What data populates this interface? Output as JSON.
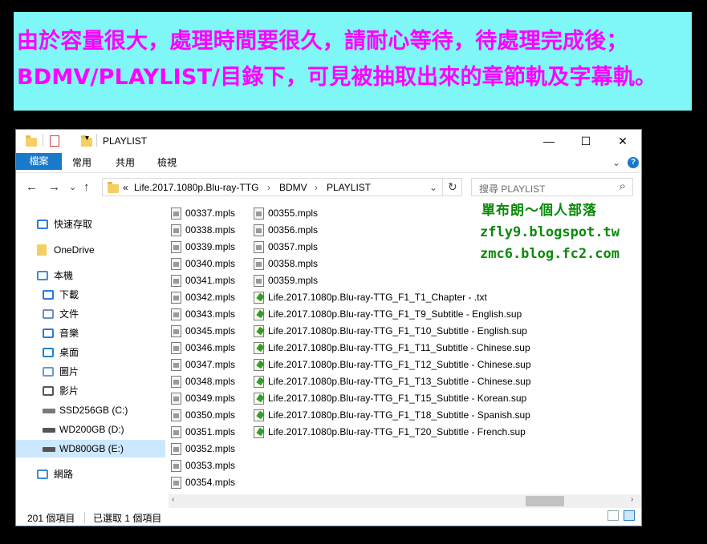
{
  "banner": {
    "line1": "由於容量很大，處理時間要很久，請耐心等待，待處理完成後；",
    "line2": "BDMV/PLAYLIST/目錄下，可見被抽取出來的章節軌及字幕軌。"
  },
  "window": {
    "title": "PLAYLIST",
    "controls": {
      "minimize": "—",
      "maximize": "☐",
      "close": "✕"
    }
  },
  "ribbon": {
    "tabs": [
      "檔案",
      "常用",
      "共用",
      "檢視"
    ],
    "expand": "⌄",
    "help": "?"
  },
  "address": {
    "back": "←",
    "forward": "→",
    "recent": "⌄",
    "up": "↑",
    "prefix": "«",
    "crumbs": [
      "Life.2017.1080p.Blu-ray-TTG",
      "BDMV",
      "PLAYLIST"
    ],
    "separator": "›",
    "dropdown": "⌄",
    "refresh": "↻",
    "search_placeholder": "搜尋 PLAYLIST",
    "search_icon": "⌕"
  },
  "nav": [
    {
      "label": "快速存取",
      "icon": "star-icon",
      "indent": 1
    },
    {
      "label": "OneDrive",
      "icon": "folder-icon",
      "indent": 1
    },
    {
      "label": "本機",
      "icon": "computer-icon",
      "indent": 1
    },
    {
      "label": "下載",
      "icon": "download-icon",
      "indent": 2
    },
    {
      "label": "文件",
      "icon": "document-icon",
      "indent": 2
    },
    {
      "label": "音樂",
      "icon": "music-icon",
      "indent": 2
    },
    {
      "label": "桌面",
      "icon": "desktop-icon",
      "indent": 2
    },
    {
      "label": "圖片",
      "icon": "picture-icon",
      "indent": 2
    },
    {
      "label": "影片",
      "icon": "video-icon",
      "indent": 2
    },
    {
      "label": "SSD256GB (C:)",
      "icon": "drive-c-icon",
      "indent": 2
    },
    {
      "label": "WD200GB (D:)",
      "icon": "drive-icon",
      "indent": 2
    },
    {
      "label": "WD800GB (E:)",
      "icon": "drive-icon",
      "indent": 2,
      "selected": true
    },
    {
      "label": "網路",
      "icon": "network-icon",
      "indent": 1
    }
  ],
  "files_col1": [
    "00337.mpls",
    "00338.mpls",
    "00339.mpls",
    "00340.mpls",
    "00341.mpls",
    "00342.mpls",
    "00343.mpls",
    "00345.mpls",
    "00346.mpls",
    "00347.mpls",
    "00348.mpls",
    "00349.mpls",
    "00350.mpls",
    "00351.mpls",
    "00352.mpls",
    "00353.mpls",
    "00354.mpls"
  ],
  "files_col2": [
    "00355.mpls",
    "00356.mpls",
    "00357.mpls",
    "00358.mpls",
    "00359.mpls",
    "Life.2017.1080p.Blu-ray-TTG_F1_T1_Chapter - .txt",
    "Life.2017.1080p.Blu-ray-TTG_F1_T9_Subtitle - English.sup",
    "Life.2017.1080p.Blu-ray-TTG_F1_T10_Subtitle - English.sup",
    "Life.2017.1080p.Blu-ray-TTG_F1_T11_Subtitle - Chinese.sup",
    "Life.2017.1080p.Blu-ray-TTG_F1_T12_Subtitle - Chinese.sup",
    "Life.2017.1080p.Blu-ray-TTG_F1_T13_Subtitle - Chinese.sup",
    "Life.2017.1080p.Blu-ray-TTG_F1_T15_Subtitle - Korean.sup",
    "Life.2017.1080p.Blu-ray-TTG_F1_T18_Subtitle - Spanish.sup",
    "Life.2017.1080p.Blu-ray-TTG_F1_T20_Subtitle - French.sup"
  ],
  "watermark": {
    "title": "單布朗～個人部落",
    "url1": "zfly9.blogspot.tw",
    "url2": "zmc6.blog.fc2.com"
  },
  "status": {
    "count": "201 個項目",
    "selected": "已選取 1 個項目"
  },
  "scroll": {
    "left": "‹",
    "right": "›"
  },
  "colors": {
    "banner_bg": "#7ff7f7",
    "banner_text": "#ff00ff",
    "accent": "#1979ca",
    "watermark": "#0a8a0a"
  }
}
